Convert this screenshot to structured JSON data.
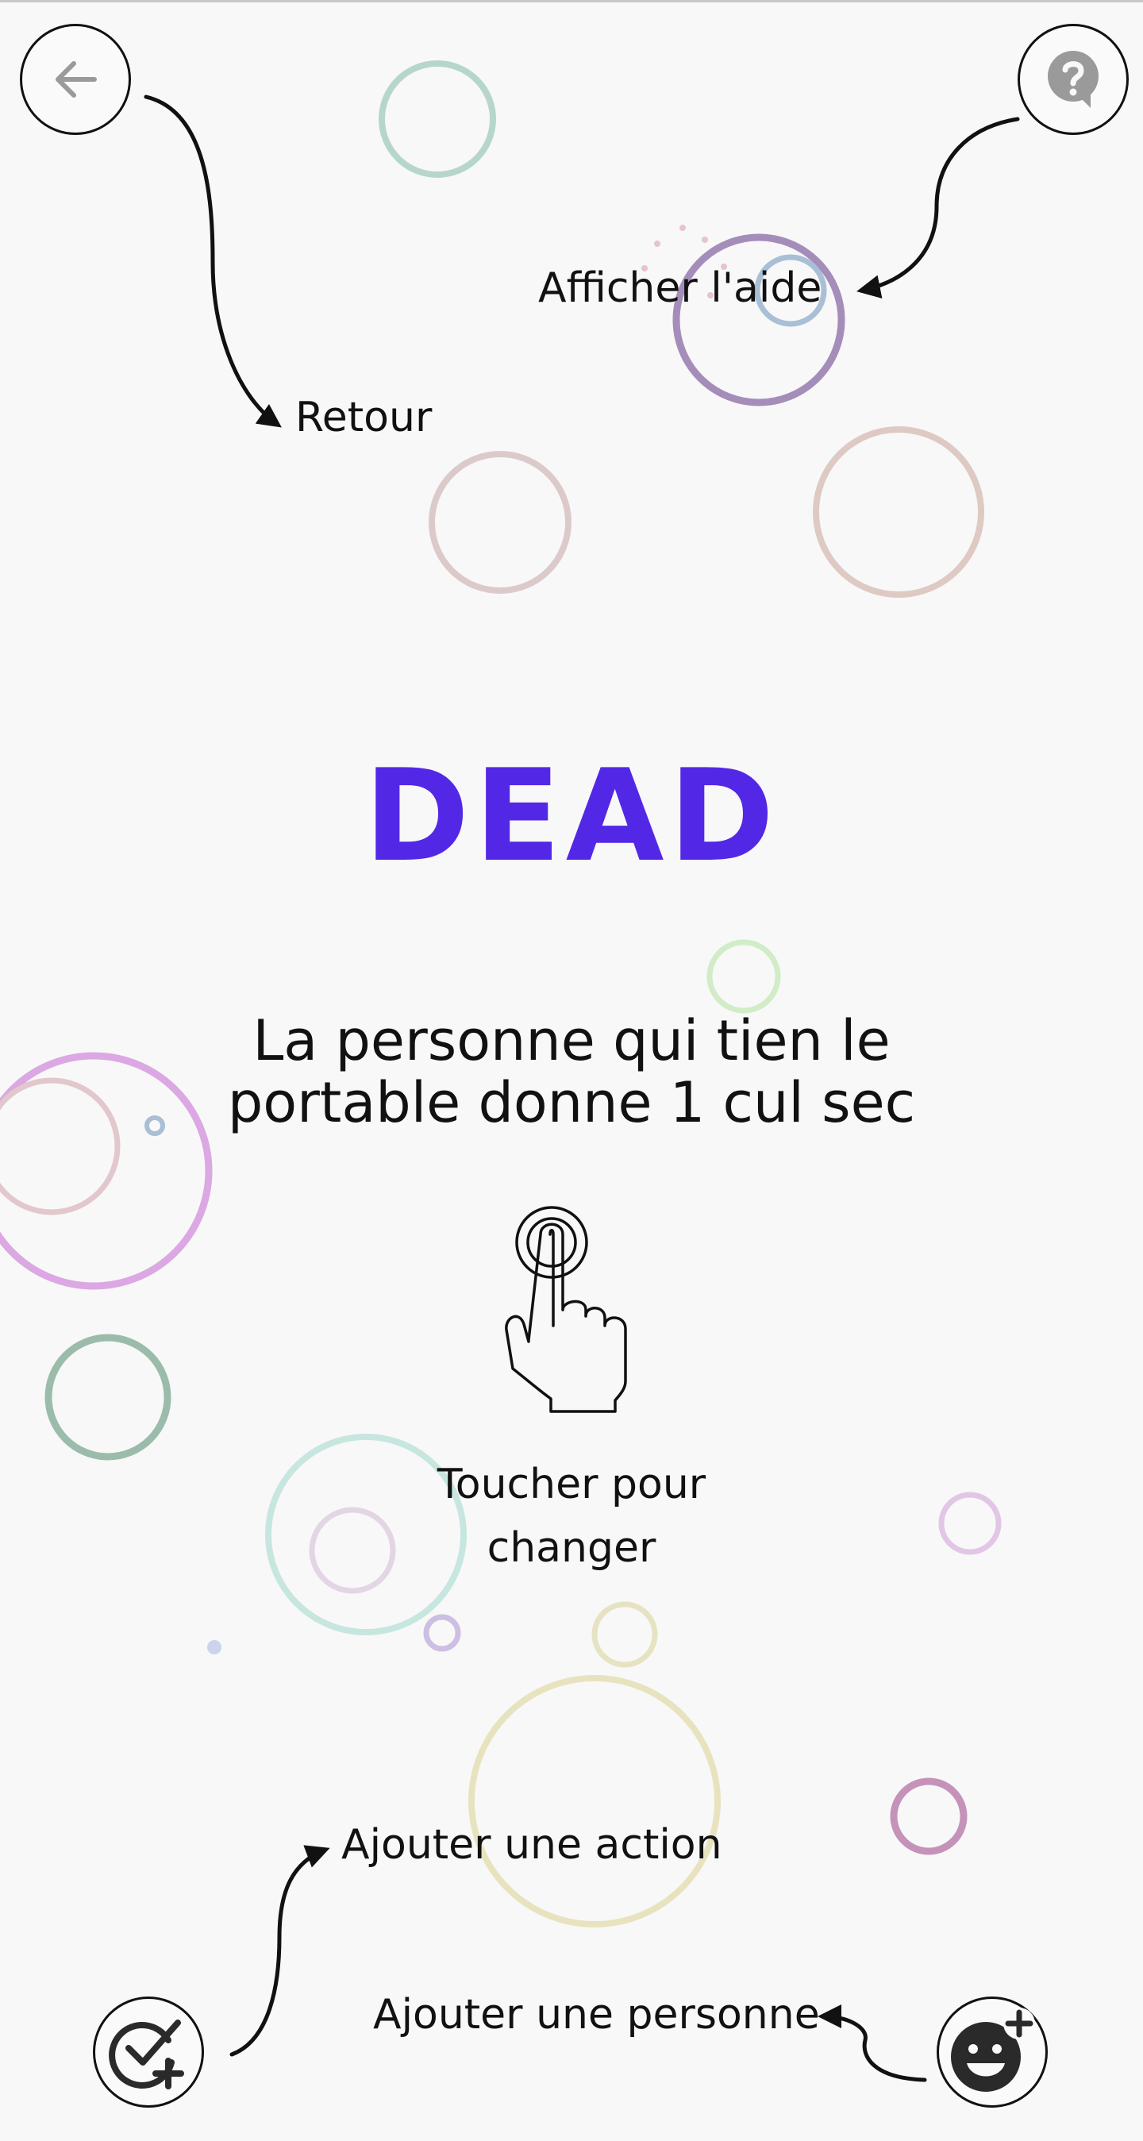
{
  "card": {
    "title": "DEAD",
    "title_color": "#5228e6",
    "sentence": "La personne qui tien le portable donne 1 cul sec"
  },
  "hints": {
    "back": "Retour",
    "help": "Afficher l'aide",
    "tap": "Toucher pour changer",
    "add_action": "Ajouter une action",
    "add_person": "Ajouter une personne"
  },
  "icons": {
    "back": "arrow-left-icon",
    "help": "help-bubble-icon",
    "tap": "tap-hand-icon",
    "add_action": "check-plus-icon",
    "add_person": "smiley-plus-icon"
  },
  "colors": {
    "background": "#f8f8f8",
    "icon_gray": "#9a9a9a",
    "ink": "#111111"
  }
}
